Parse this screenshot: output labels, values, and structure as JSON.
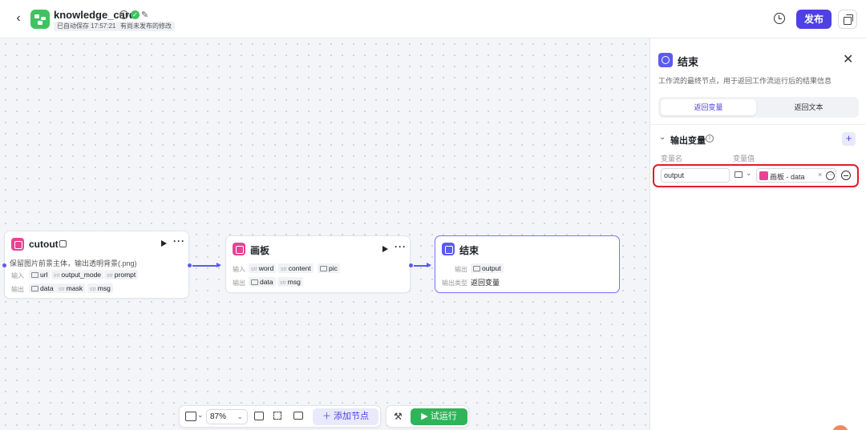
{
  "header": {
    "back_icon": "chevron-left-icon",
    "app_icon": "workflow-icon",
    "app_name": "knowledge_card",
    "autosave_tag": "已自动保存 17:57:21",
    "unpublished_tag": "有尚未发布的修改",
    "publish_label": "发布",
    "history_icon": "history-icon",
    "copy_icon": "copy-icon",
    "accent": "#4e40e5"
  },
  "nodes": {
    "cutout": {
      "title": "cutout",
      "desc": "保留图片前景主体，输出透明背景(.png)",
      "input_label": "输入",
      "output_label": "输出",
      "inputs": [
        {
          "type": "",
          "name": "url"
        },
        {
          "type": "int",
          "name": "output_mode"
        },
        {
          "type": "str",
          "name": "prompt"
        }
      ],
      "outputs": [
        {
          "type": "",
          "name": "data"
        },
        {
          "type": "str",
          "name": "mask"
        },
        {
          "type": "str",
          "name": "msg"
        }
      ]
    },
    "canvas_board": {
      "title": "画板",
      "input_label": "输入",
      "output_label": "输出",
      "inputs": [
        {
          "type": "str",
          "name": "word"
        },
        {
          "type": "str",
          "name": "content"
        },
        {
          "type": "",
          "name": "pic"
        }
      ],
      "outputs": [
        {
          "type": "",
          "name": "data"
        },
        {
          "type": "str",
          "name": "msg"
        }
      ]
    },
    "end": {
      "title": "结束",
      "output_label": "输出",
      "output_var": "output",
      "output_type_label": "输出类型",
      "output_type_value": "返回变量"
    }
  },
  "toolbar": {
    "zoom": "87%",
    "add_node_label": "添加节点",
    "trial_run_label": "试运行"
  },
  "panel": {
    "title": "结束",
    "desc": "工作流的最终节点，用于返回工作流运行后的结果信息",
    "tabs": [
      "返回变量",
      "返回文本"
    ],
    "active_tab": 0,
    "section_title": "输出变量",
    "col_name": "变量名",
    "col_value": "变量值",
    "variable": {
      "name": "output",
      "value": "画板 - data"
    }
  }
}
